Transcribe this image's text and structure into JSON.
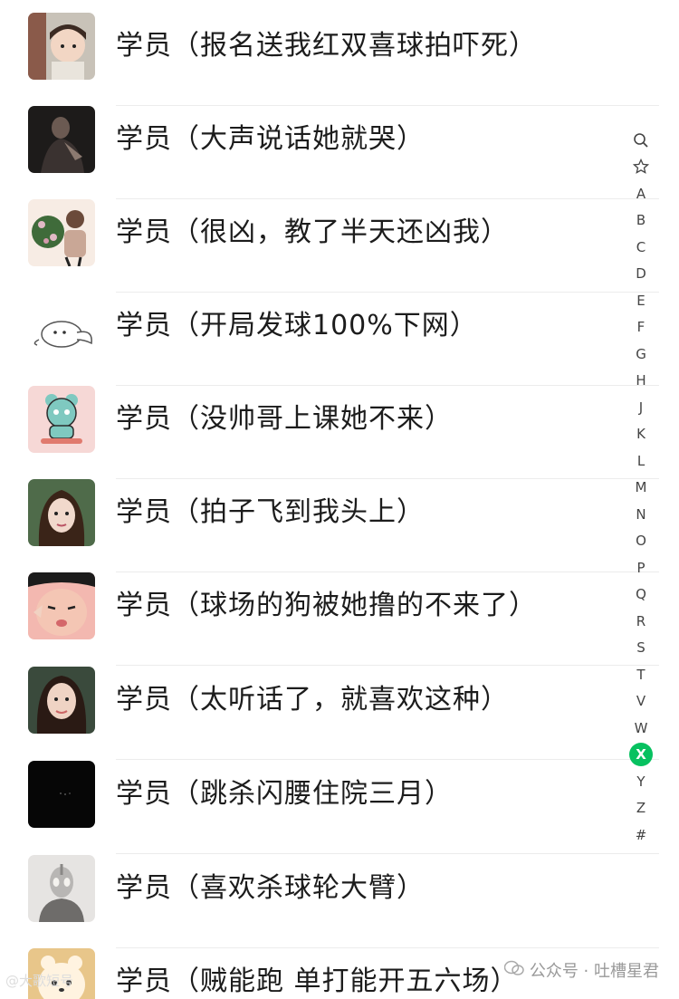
{
  "contacts": [
    {
      "name": "学员（报名送我红双喜球拍吓死）",
      "avatar": "child-photo-avatar"
    },
    {
      "name": "学员（大声说话她就哭）",
      "avatar": "dark-portrait-avatar"
    },
    {
      "name": "学员（很凶，教了半天还凶我）",
      "avatar": "flower-girl-avatar"
    },
    {
      "name": "学员（开局发球100%下网）",
      "avatar": "cartoon-rabbit-avatar"
    },
    {
      "name": "学员（没帅哥上课她不来）",
      "avatar": "cartoon-bear-avatar"
    },
    {
      "name": "学员（拍子飞到我头上）",
      "avatar": "woman-selfie-avatar"
    },
    {
      "name": "学员（球场的狗被她撸的不来了）",
      "avatar": "funny-face-avatar"
    },
    {
      "name": "学员（太听话了，就喜欢这种）",
      "avatar": "woman-portrait-avatar"
    },
    {
      "name": "学员（跳杀闪腰住院三月）",
      "avatar": "black-night-avatar"
    },
    {
      "name": "学员（喜欢杀球轮大臂）",
      "avatar": "ultraman-avatar"
    },
    {
      "name": "学员（贼能跑 单打能开五六场）",
      "avatar": "cartoon-cat-avatar"
    }
  ],
  "index_bar": {
    "items": [
      "🔍",
      "☆",
      "A",
      "B",
      "C",
      "D",
      "E",
      "F",
      "G",
      "H",
      "J",
      "K",
      "L",
      "M",
      "N",
      "O",
      "P",
      "Q",
      "R",
      "S",
      "T",
      "V",
      "W",
      "X",
      "Y",
      "Z",
      "#"
    ],
    "active": "X",
    "active_color": "#07c160"
  },
  "watermark": {
    "text": "公众号 · 吐槽星君"
  },
  "watermark_left": {
    "text": "@大歌短号"
  }
}
